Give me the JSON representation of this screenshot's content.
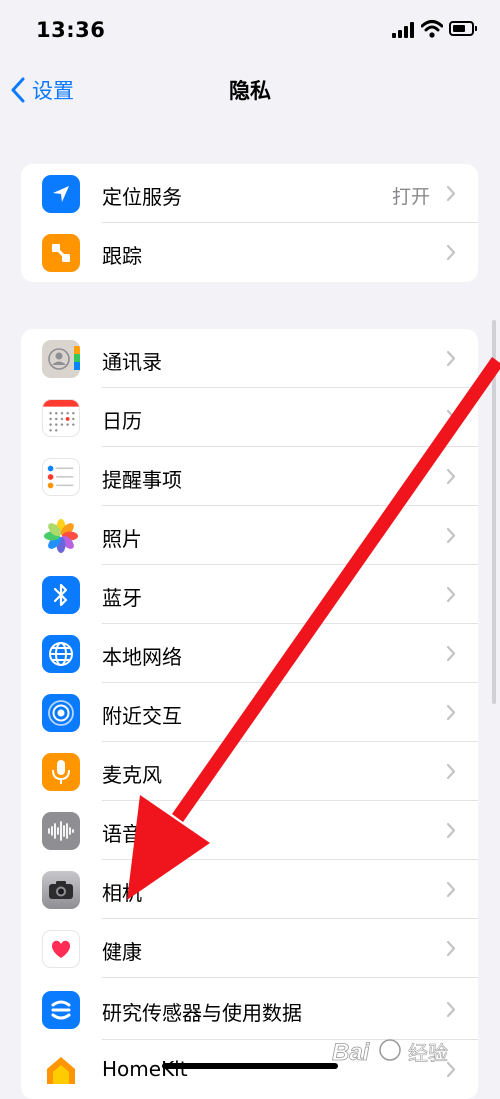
{
  "status_bar": {
    "time": "13:36"
  },
  "nav": {
    "back_label": "设置",
    "title": "隐私"
  },
  "groups": [
    {
      "items": [
        {
          "label": "定位服务",
          "value": "打开",
          "icon": "location-arrow-icon",
          "icon_bg": "#0a7aff"
        },
        {
          "label": "跟踪",
          "icon": "tracking-icon",
          "icon_bg": "#ff9500"
        }
      ]
    },
    {
      "items": [
        {
          "label": "通讯录",
          "icon": "contacts-icon",
          "icon_bg": "#d9d4cd"
        },
        {
          "label": "日历",
          "icon": "calendar-icon",
          "icon_bg": "#ffffff"
        },
        {
          "label": "提醒事项",
          "icon": "reminders-icon",
          "icon_bg": "#ffffff"
        },
        {
          "label": "照片",
          "icon": "photos-icon",
          "icon_bg": "#ffffff"
        },
        {
          "label": "蓝牙",
          "icon": "bluetooth-icon",
          "icon_bg": "#0a7aff"
        },
        {
          "label": "本地网络",
          "icon": "globe-icon",
          "icon_bg": "#0a7aff"
        },
        {
          "label": "附近交互",
          "icon": "nearby-interactions-icon",
          "icon_bg": "#0a7aff"
        },
        {
          "label": "麦克风",
          "icon": "microphone-icon",
          "icon_bg": "#ff9500"
        },
        {
          "label": "语音",
          "icon": "speech-waveform-icon",
          "icon_bg": "#8e8e93"
        },
        {
          "label": "相机",
          "icon": "camera-icon",
          "icon_bg": "#8e8e93"
        },
        {
          "label": "健康",
          "icon": "health-heart-icon",
          "icon_bg": "#ffffff"
        },
        {
          "label": "研究传感器与使用数据",
          "icon": "research-sensor-icon",
          "icon_bg": "#0a7aff"
        },
        {
          "label": "HomeKit",
          "icon": "homekit-house-icon",
          "icon_bg": "#ff9500"
        }
      ]
    }
  ],
  "watermark": {
    "text": "Bai 经验"
  },
  "colors": {
    "accent": "#0a7aff",
    "background": "#f2f2f7",
    "annotation_arrow": "#f0151c"
  }
}
